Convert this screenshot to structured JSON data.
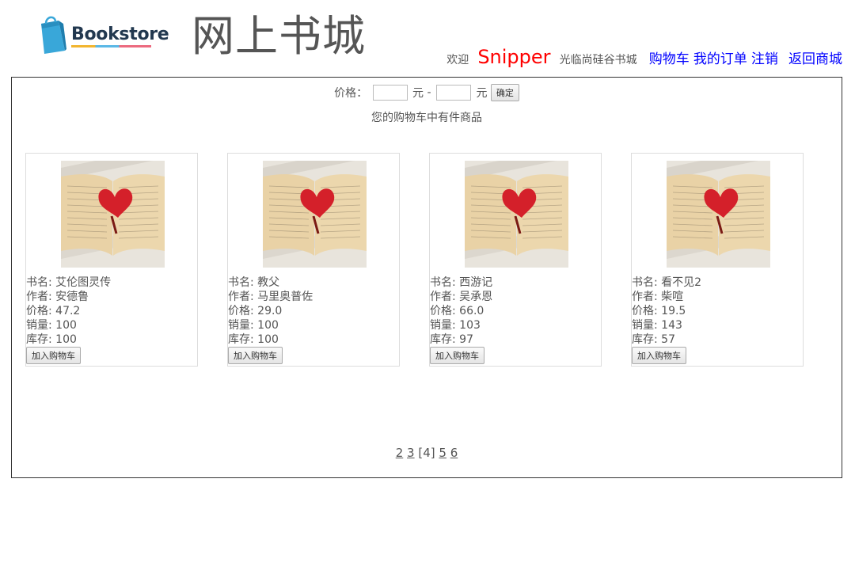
{
  "header": {
    "logo_text": "Bookstore",
    "site_title": "网上书城",
    "welcome": "欢迎",
    "username": "Snipper",
    "welcome_suffix": "光临尚硅谷书城",
    "links": {
      "cart": "购物车",
      "orders": "我的订单",
      "logout": "注销",
      "back": "返回商城"
    }
  },
  "filter": {
    "price_label": "价格：",
    "unit": "元",
    "dash": "-",
    "min_value": "",
    "max_value": "",
    "confirm": "确定"
  },
  "cart_info": "您的购物车中有件商品",
  "books": [
    {
      "name_label": "书名:",
      "name": "艾伦图灵传",
      "author_label": "作者:",
      "author": "安德鲁",
      "price_label": "价格:",
      "price": "47.2",
      "sales_label": "销量:",
      "sales": "100",
      "stock_label": "库存:",
      "stock": "100",
      "add_button": "加入购物车"
    },
    {
      "name_label": "书名:",
      "name": "教父",
      "author_label": "作者:",
      "author": "马里奥普佐",
      "price_label": "价格:",
      "price": "29.0",
      "sales_label": "销量:",
      "sales": "100",
      "stock_label": "库存:",
      "stock": "100",
      "add_button": "加入购物车"
    },
    {
      "name_label": "书名:",
      "name": "西游记",
      "author_label": "作者:",
      "author": "吴承恩",
      "price_label": "价格:",
      "price": "66.0",
      "sales_label": "销量:",
      "sales": "103",
      "stock_label": "库存:",
      "stock": "97",
      "add_button": "加入购物车"
    },
    {
      "name_label": "书名:",
      "name": "看不见2",
      "author_label": "作者:",
      "author": "柴喧",
      "price_label": "价格:",
      "price": "19.5",
      "sales_label": "销量:",
      "sales": "143",
      "stock_label": "库存:",
      "stock": "57",
      "add_button": "加入购物车"
    }
  ],
  "pager": {
    "pages": [
      "2",
      "3"
    ],
    "current": "[4]",
    "pages_after": [
      "5",
      "6"
    ]
  },
  "colors": {
    "username": "#ff0000",
    "link": "#0000ff",
    "border": "#333333"
  }
}
